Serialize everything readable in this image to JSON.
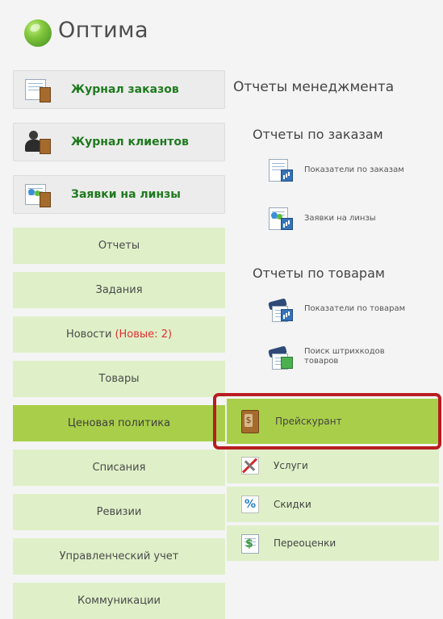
{
  "app": {
    "title": "Оптима"
  },
  "left_menu": {
    "journals": [
      {
        "label": "Журнал заказов",
        "icon": "orders-journal-icon"
      },
      {
        "label": "Журнал клиентов",
        "icon": "clients-journal-icon"
      },
      {
        "label": "Заявки на линзы",
        "icon": "lens-requests-icon"
      }
    ],
    "items": [
      {
        "label": "Отчеты"
      },
      {
        "label": "Задания"
      },
      {
        "label": "Новости",
        "badge": "(Новые: 2)"
      },
      {
        "label": "Товары"
      },
      {
        "label": "Ценовая политика",
        "active": true
      },
      {
        "label": "Списания"
      },
      {
        "label": "Ревизии"
      },
      {
        "label": "Управленческий учет"
      },
      {
        "label": "Коммуникации"
      }
    ]
  },
  "right_panel": {
    "title": "Отчеты менеджмента",
    "sections": [
      {
        "title": "Отчеты по заказам",
        "links": [
          {
            "label": "Показатели по заказам",
            "icon": "order-report-icon"
          },
          {
            "label": "Заявки на линзы",
            "icon": "lens-report-icon"
          }
        ]
      },
      {
        "title": "Отчеты по товарам",
        "links": [
          {
            "label": "Показатели по товарам",
            "icon": "goods-report-icon"
          },
          {
            "label": "Поиск штрихкодов товаров",
            "icon": "barcode-search-icon"
          }
        ]
      }
    ],
    "pricing_items": [
      {
        "label": "Прейскурант",
        "icon": "price-list-icon",
        "active": true
      },
      {
        "label": "Услуги",
        "icon": "services-icon"
      },
      {
        "label": "Скидки",
        "icon": "discounts-icon"
      },
      {
        "label": "Переоценки",
        "icon": "revaluation-icon"
      }
    ]
  },
  "colors": {
    "menu_bg": "#dff0c8",
    "menu_active": "#a9cf4a",
    "journal_text": "#1f7a1f",
    "highlight_border": "#b81d21",
    "badge_text": "#e03030"
  }
}
